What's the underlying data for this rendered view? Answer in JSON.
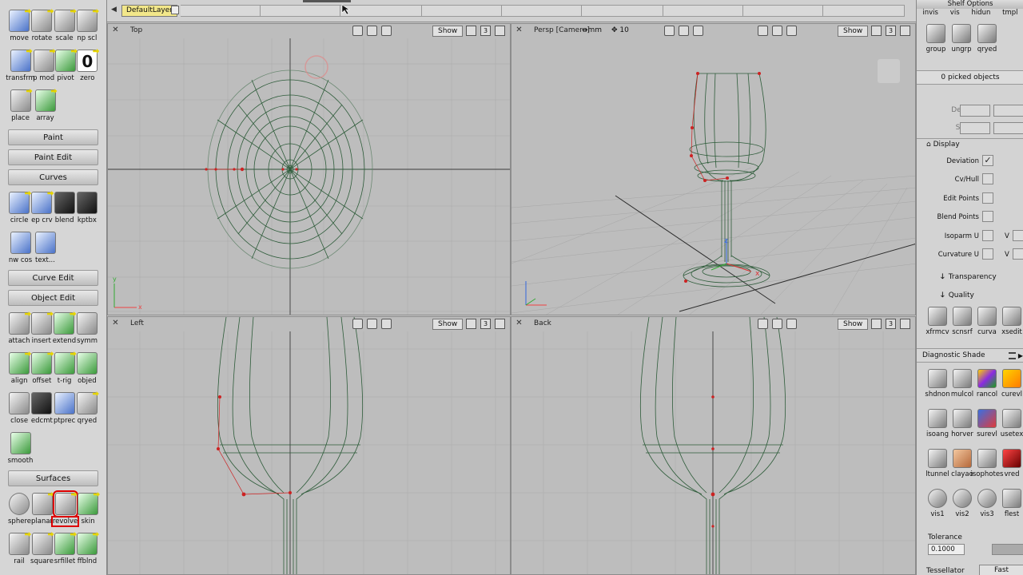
{
  "palette": {
    "row1": [
      {
        "label": "move",
        "icon": "move-icon"
      },
      {
        "label": "rotate",
        "icon": "rotate-icon"
      },
      {
        "label": "scale",
        "icon": "scale-icon"
      },
      {
        "label": "np scl",
        "icon": "nonprop-scale-icon"
      }
    ],
    "row2": [
      {
        "label": "transfrm",
        "icon": "transform-icon"
      },
      {
        "label": "p mod",
        "icon": "pivot-mod-icon"
      },
      {
        "label": "pivot",
        "icon": "pivot-icon"
      },
      {
        "label": "zero",
        "icon": "zero-icon",
        "glyph": "0"
      }
    ],
    "row3": [
      {
        "label": "place",
        "icon": "place-icon"
      },
      {
        "label": "array",
        "icon": "array-icon"
      }
    ],
    "sections": {
      "paint": "Paint",
      "paint_edit": "Paint Edit",
      "curves": "Curves",
      "curve_edit": "Curve Edit",
      "object_edit": "Object Edit",
      "surfaces": "Surfaces"
    },
    "curves1": [
      {
        "label": "circle",
        "icon": "circle-icon"
      },
      {
        "label": "ep crv",
        "icon": "ep-curve-icon"
      },
      {
        "label": "blend",
        "icon": "blend-curve-icon"
      },
      {
        "label": "kptbx",
        "icon": "keypoint-toolbox-icon"
      }
    ],
    "curves2": [
      {
        "label": "nw cos",
        "icon": "new-cos-icon"
      },
      {
        "label": "text...",
        "icon": "text-icon"
      }
    ],
    "objedit1": [
      {
        "label": "attach",
        "icon": "attach-icon"
      },
      {
        "label": "insert",
        "icon": "insert-icon"
      },
      {
        "label": "extend",
        "icon": "extend-icon"
      },
      {
        "label": "symm",
        "icon": "symmetry-icon"
      }
    ],
    "objedit2": [
      {
        "label": "align",
        "icon": "align-icon"
      },
      {
        "label": "offset",
        "icon": "offset-icon"
      },
      {
        "label": "t-rig",
        "icon": "transform-rig-icon"
      },
      {
        "label": "objed",
        "icon": "object-edit-icon"
      }
    ],
    "objedit3": [
      {
        "label": "close",
        "icon": "close-surface-icon"
      },
      {
        "label": "edcmt",
        "icon": "edit-cmt-icon"
      },
      {
        "label": "ptprec",
        "icon": "point-precision-icon"
      },
      {
        "label": "qryed",
        "icon": "query-edit-icon"
      }
    ],
    "objedit4": [
      {
        "label": "smooth",
        "icon": "smooth-icon"
      }
    ],
    "surf1": [
      {
        "label": "sphere",
        "icon": "sphere-icon"
      },
      {
        "label": "planar",
        "icon": "planar-icon"
      },
      {
        "label": "revolve",
        "icon": "revolve-icon"
      },
      {
        "label": "skin",
        "icon": "skin-icon"
      }
    ],
    "surf2": [
      {
        "label": "rail",
        "icon": "rail-icon"
      },
      {
        "label": "square",
        "icon": "square-surface-icon"
      },
      {
        "label": "srfillet",
        "icon": "surface-fillet-icon"
      },
      {
        "label": "ffblnd",
        "icon": "freeform-blend-icon"
      }
    ]
  },
  "layerbar": {
    "default_layer": "DefaultLayer"
  },
  "viewports": {
    "top": {
      "name": "Top",
      "show": "Show",
      "count": "3"
    },
    "persp": {
      "name": "Persp [Camera]",
      "units": "↔mm",
      "step_label": "10",
      "show": "Show",
      "count": "3"
    },
    "left": {
      "name": "Left",
      "show": "Show",
      "count": "3"
    },
    "back": {
      "name": "Back",
      "show": "Show",
      "count": "3"
    }
  },
  "axes": {
    "x": "x",
    "y": "y",
    "z": "z"
  },
  "right_panel": {
    "shelf_options": "Shelf Options",
    "tabs": [
      "invis",
      "vis",
      "hidun",
      "tmpl"
    ],
    "group_tools": [
      {
        "label": "group",
        "icon": "group-icon"
      },
      {
        "label": "ungrp",
        "icon": "ungroup-icon"
      },
      {
        "label": "qryed",
        "icon": "query-edit-icon"
      }
    ],
    "picked": "0 picked objects",
    "degree_label": "Degree",
    "spans_label": "Spans",
    "display_label": "Display",
    "checks": [
      {
        "label": "Deviation",
        "checked": "✓"
      },
      {
        "label": "Cv/Hull",
        "checked": ""
      },
      {
        "label": "Edit Points",
        "checked": ""
      },
      {
        "label": "Blend Points",
        "checked": ""
      },
      {
        "label": "Isoparm U",
        "checked": "",
        "v": "V"
      },
      {
        "label": "Curvature U",
        "checked": "",
        "v": "V"
      }
    ],
    "transparency": "Transparency",
    "quality": "Quality",
    "mid_tools": [
      {
        "label": "xfrmcv",
        "icon": "transform-cv-icon"
      },
      {
        "label": "scnsrf",
        "icon": "scan-surface-icon"
      },
      {
        "label": "curva",
        "icon": "curvature-icon"
      },
      {
        "label": "xsedit",
        "icon": "xsection-edit-icon"
      }
    ],
    "diag_title": "Diagnostic Shade",
    "diag_rows": [
      [
        {
          "label": "shdnon",
          "icon": "shade-off-icon"
        },
        {
          "label": "mulcol",
          "icon": "multi-color-icon"
        },
        {
          "label": "rancol",
          "icon": "random-color-icon"
        },
        {
          "label": "curevl",
          "icon": "curvature-eval-icon"
        }
      ],
      [
        {
          "label": "isoang",
          "icon": "isoangle-icon"
        },
        {
          "label": "horver",
          "icon": "horizontal-vertical-icon"
        },
        {
          "label": "surevl",
          "icon": "surface-eval-icon"
        },
        {
          "label": "usetex",
          "icon": "use-texture-icon"
        }
      ],
      [
        {
          "label": "ltunnel",
          "icon": "light-tunnel-icon"
        },
        {
          "label": "clayao",
          "icon": "clay-ao-icon"
        },
        {
          "label": "isophotes",
          "icon": "isophotes-icon"
        },
        {
          "label": "vred",
          "icon": "vred-icon"
        }
      ],
      [
        {
          "label": "vis1",
          "icon": "vis1-icon"
        },
        {
          "label": "vis2",
          "icon": "vis2-icon"
        },
        {
          "label": "vis3",
          "icon": "vis3-icon"
        },
        {
          "label": "flest",
          "icon": "flest-icon"
        }
      ]
    ],
    "tolerance_label": "Tolerance",
    "tolerance_value": "0.1000",
    "tessellator_label": "Tessellator",
    "tessellator_value": "Fast"
  },
  "colors": {
    "viewport_bg": "#bdbdbd",
    "wire": "#2e5c3a",
    "grid": "#a9a9a9",
    "cv_red": "#cc2222",
    "layer_yellow": "#f2e78a",
    "select_red": "#dd0000"
  }
}
